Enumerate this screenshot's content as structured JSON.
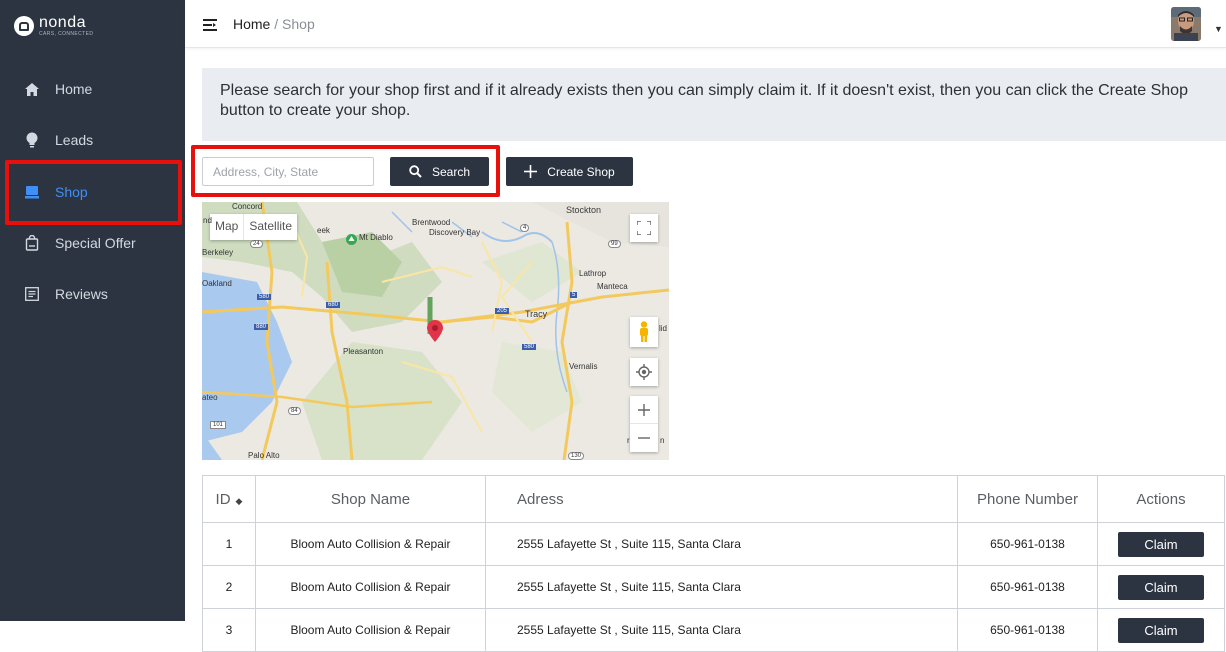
{
  "brand": {
    "name": "nonda",
    "tagline": "CARS, CONNECTED"
  },
  "sidebar": {
    "items": [
      {
        "label": "Home",
        "icon": "home-icon"
      },
      {
        "label": "Leads",
        "icon": "lightbulb-icon"
      },
      {
        "label": "Shop",
        "icon": "shop-icon",
        "active": true
      },
      {
        "label": "Special Offer",
        "icon": "offer-bag-icon"
      },
      {
        "label": "Reviews",
        "icon": "reviews-icon"
      }
    ],
    "active_color": "#3f8ff5"
  },
  "breadcrumb": {
    "home": "Home",
    "separator": "/",
    "current": "Shop"
  },
  "notice": "Please search for your shop first and if it already exists then you can simply claim it. If it doesn't exist, then you can click the Create Shop button to create your shop.",
  "search": {
    "placeholder": "Address, City, State",
    "value": "",
    "button_label": "Search"
  },
  "create_shop_label": "Create Shop",
  "map": {
    "type_map": "Map",
    "type_satellite": "Satellite",
    "labels": {
      "stockton": "Stockton",
      "brentwood": "Brentwood",
      "discovery_bay": "Discovery Bay",
      "mt_diablo": "Mt Diablo",
      "berkeley": "Berkeley",
      "oakland": "Oakland",
      "lathrop": "Lathrop",
      "manteca": "Manteca",
      "tracy": "Tracy",
      "pleasanton": "Pleasanton",
      "vernalis": "Vernalis",
      "mateo": "ateo",
      "palo_alto": "Palo Alto",
      "eek": "eek",
      "lid": "lid",
      "n": "n",
      "r": "r",
      "nd": "nd",
      "concord": "Concord"
    },
    "shields": [
      "24",
      "4",
      "99",
      "580",
      "680",
      "205",
      "5",
      "880",
      "580",
      "84",
      "101",
      "130"
    ]
  },
  "table": {
    "headers": {
      "id": "ID",
      "name": "Shop Name",
      "address": "Adress",
      "phone": "Phone Number",
      "actions": "Actions"
    },
    "rows": [
      {
        "id": "1",
        "name": "Bloom Auto Collision & Repair",
        "address": "2555 Lafayette St , Suite 115, Santa Clara",
        "phone": "650-961-0138",
        "action": "Claim"
      },
      {
        "id": "2",
        "name": "Bloom Auto Collision & Repair",
        "address": "2555 Lafayette St , Suite 115, Santa Clara",
        "phone": "650-961-0138",
        "action": "Claim"
      },
      {
        "id": "3",
        "name": "Bloom Auto Collision & Repair",
        "address": "2555 Lafayette St , Suite 115, Santa Clara",
        "phone": "650-961-0138",
        "action": "Claim"
      }
    ]
  },
  "colors": {
    "sidebar_bg": "#2c3442",
    "button_bg": "#2c3442",
    "highlight": "#e8100d",
    "map_pin": "#e0344a"
  }
}
